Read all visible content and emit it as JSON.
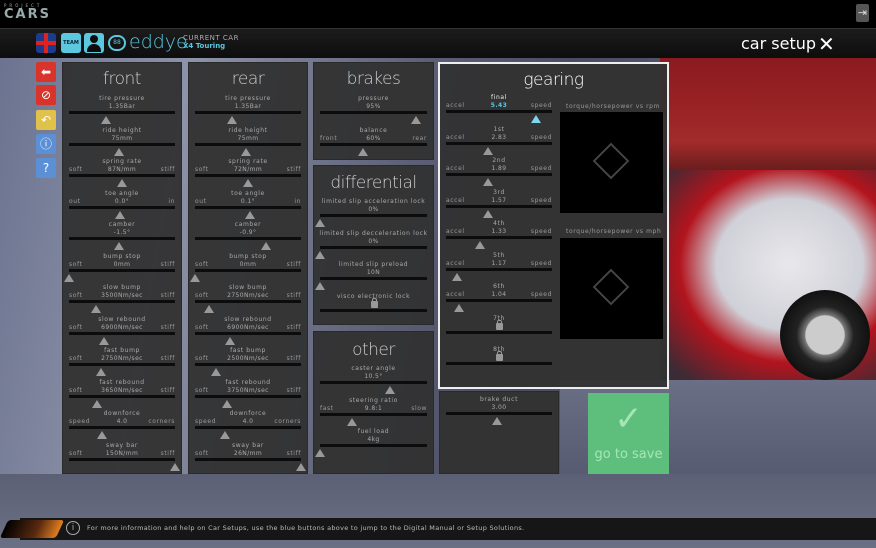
{
  "app": {
    "logo_small": "PROJECT",
    "logo_big": "CARS"
  },
  "header": {
    "team_badge": "TEAM",
    "rank": "88",
    "username": "eddye",
    "current_car_label": "CURRENT CAR",
    "current_car": "X4 Touring",
    "page_title": "car setup"
  },
  "front": {
    "title": "front",
    "rows": [
      {
        "label": "tire pressure",
        "value": "1.35Bar",
        "pos": 0.35
      },
      {
        "label": "ride height",
        "value": "75mm",
        "pos": 0.47
      },
      {
        "label": "spring rate",
        "value": "87N/mm",
        "left": "soft",
        "right": "stiff",
        "pos": 0.5
      },
      {
        "label": "toe angle",
        "value": "0.0°",
        "left": "out",
        "right": "in",
        "pos": 0.48
      },
      {
        "label": "camber",
        "value": "-1.5°",
        "pos": 0.47
      },
      {
        "label": "bump stop",
        "value": "0mm",
        "left": "soft",
        "right": "stiff",
        "pos": 0.0
      },
      {
        "label": "slow bump",
        "value": "3500Nm/sec",
        "left": "soft",
        "right": "stiff",
        "pos": 0.25
      },
      {
        "label": "slow rebound",
        "value": "6900Nm/sec",
        "left": "soft",
        "right": "stiff",
        "pos": 0.33
      },
      {
        "label": "fast bump",
        "value": "2750Nm/sec",
        "left": "soft",
        "right": "stiff",
        "pos": 0.3
      },
      {
        "label": "fast rebound",
        "value": "3650Nm/sec",
        "left": "soft",
        "right": "stiff",
        "pos": 0.26
      },
      {
        "label": "downforce",
        "value": "4.0",
        "left": "speed",
        "right": "corners",
        "pos": 0.31
      },
      {
        "label": "sway bar",
        "value": "150N/mm",
        "left": "soft",
        "right": "stiff",
        "pos": 1.0
      }
    ]
  },
  "rear": {
    "title": "rear",
    "rows": [
      {
        "label": "tire pressure",
        "value": "1.35Bar",
        "pos": 0.35
      },
      {
        "label": "ride height",
        "value": "75mm",
        "pos": 0.48
      },
      {
        "label": "spring rate",
        "value": "72N/mm",
        "left": "soft",
        "right": "stiff",
        "pos": 0.5
      },
      {
        "label": "toe angle",
        "value": "0.1°",
        "left": "out",
        "right": "in",
        "pos": 0.52
      },
      {
        "label": "camber",
        "value": "-0.9°",
        "pos": 0.67
      },
      {
        "label": "bump stop",
        "value": "0mm",
        "left": "soft",
        "right": "stiff",
        "pos": 0.0
      },
      {
        "label": "slow bump",
        "value": "2750Nm/sec",
        "left": "soft",
        "right": "stiff",
        "pos": 0.13
      },
      {
        "label": "slow rebound",
        "value": "6900Nm/sec",
        "left": "soft",
        "right": "stiff",
        "pos": 0.33
      },
      {
        "label": "fast bump",
        "value": "2500Nm/sec",
        "left": "soft",
        "right": "stiff",
        "pos": 0.2
      },
      {
        "label": "fast rebound",
        "value": "3750Nm/sec",
        "left": "soft",
        "right": "stiff",
        "pos": 0.3
      },
      {
        "label": "downforce",
        "value": "4.0",
        "left": "speed",
        "right": "corners",
        "pos": 0.28
      },
      {
        "label": "sway bar",
        "value": "26N/mm",
        "left": "soft",
        "right": "stiff",
        "pos": 1.0
      }
    ]
  },
  "brakes": {
    "title": "brakes",
    "rows": [
      {
        "label": "pressure",
        "value": "95%",
        "pos": 0.9
      },
      {
        "label": "balance",
        "value": "60%",
        "left": "front",
        "right": "rear",
        "pos": 0.4
      }
    ]
  },
  "differential": {
    "title": "differential",
    "rows": [
      {
        "label": "limited slip acceleration lock",
        "value": "0%",
        "pos": 0.0
      },
      {
        "label": "limited slip decceleration lock",
        "value": "0%",
        "pos": 0.0
      },
      {
        "label": "limited slip preload",
        "value": "10N",
        "pos": 0.0
      },
      {
        "label": "visco electronic lock",
        "locked": true
      }
    ]
  },
  "other": {
    "title": "other",
    "rows": [
      {
        "label": "caster angle",
        "value": "10.5°",
        "pos": 0.65
      },
      {
        "label": "steering ratio",
        "value": "9.8:1",
        "left": "fast",
        "right": "slow",
        "pos": 0.3
      },
      {
        "label": "fuel load",
        "value": "4kg",
        "pos": 0.0
      }
    ]
  },
  "gearing": {
    "title": "gearing",
    "graph1_label": "torque/horsepower vs rpm",
    "graph2_label": "torque/horsepower vs mph",
    "rows": [
      {
        "label": "final",
        "value": "5.43",
        "left": "accel",
        "right": "speed",
        "pos": 0.85,
        "highlight": true
      },
      {
        "label": "1st",
        "value": "2.83",
        "left": "accel",
        "right": "speed",
        "pos": 0.4
      },
      {
        "label": "2nd",
        "value": "1.89",
        "left": "accel",
        "right": "speed",
        "pos": 0.4
      },
      {
        "label": "3rd",
        "value": "1.57",
        "left": "accel",
        "right": "speed",
        "pos": 0.4
      },
      {
        "label": "4th",
        "value": "1.33",
        "left": "accel",
        "right": "speed",
        "pos": 0.32
      },
      {
        "label": "5th",
        "value": "1.17",
        "left": "accel",
        "right": "speed",
        "pos": 0.1
      },
      {
        "label": "6th",
        "value": "1.04",
        "left": "accel",
        "right": "speed",
        "pos": 0.12
      },
      {
        "label": "7th",
        "locked": true
      },
      {
        "label": "8th",
        "locked": true
      }
    ]
  },
  "brake_duct": {
    "rows": [
      {
        "label": "brake duct",
        "value": "3.00",
        "pos": 0.48
      }
    ]
  },
  "save": {
    "label": "go to save"
  },
  "footer": {
    "text": "For more information and help on Car Setups, use the blue buttons above to jump to the Digital Manual or Setup Solutions."
  },
  "colors": {
    "accent": "#5bc8e0",
    "save": "#5ebf7d",
    "red_button": "#d9342b",
    "yellow_button": "#e0c24a",
    "blue_button": "#5b8fd6"
  }
}
